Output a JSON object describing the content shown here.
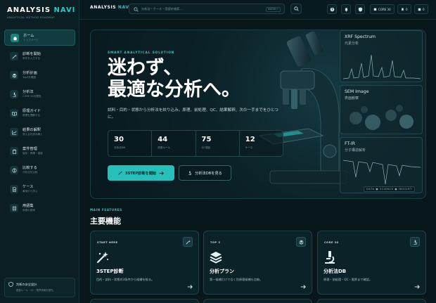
{
  "brand": {
    "name_main": "ANALYSIS",
    "name_accent": "NAVI",
    "tagline": "ANALYTICAL METHOD ROADMAP"
  },
  "topbar": {
    "title_main": "ANALYSIS",
    "title_accent": "NAVI",
    "search_placeholder": "分析法・ケース・用語を検索...",
    "search_shortcut": "ENTER ↵",
    "pills": {
      "core": "CORE 30",
      "saved": "0",
      "history": "0"
    }
  },
  "sidebar": {
    "items": [
      {
        "label": "ホーム",
        "sub": "トップページ",
        "icon": "home-icon"
      },
      {
        "label": "診断を開始",
        "sub": "条件を入力する",
        "icon": "wand-icon"
      },
      {
        "label": "分析計画",
        "sub": "Top3を確認",
        "icon": "layers-icon"
      },
      {
        "label": "分析法",
        "sub": "CORE 30を閲覧",
        "icon": "microscope-icon"
      },
      {
        "label": "原理ガイド",
        "sub": "原理を理解する",
        "icon": "book-icon"
      },
      {
        "label": "結果の解釈",
        "sub": "見えるを読み解く",
        "icon": "chart-icon"
      },
      {
        "label": "案件管理",
        "sub": "保存・再確・複製",
        "icon": "clipboard-icon"
      },
      {
        "label": "比較する",
        "sub": "分析法を比較",
        "icon": "compare-icon"
      },
      {
        "label": "ケース",
        "sub": "事例から学ぶ",
        "icon": "case-icon"
      },
      {
        "label": "用語集",
        "sub": "用語の説明",
        "icon": "glossary-icon"
      }
    ],
    "notice": {
      "title": "判断の安全設計",
      "sub": "推奨ルール・QC・限界情報を優先。"
    }
  },
  "hero": {
    "kicker": "SMART ANALYTICAL SOLUTION",
    "title_line1": "迷わず、",
    "title_line2": "最適な分析へ。",
    "description": "試料・目的・状態から分析法を絞り込み。原理、前処理、QC、結果解釈、次の一手までをひとつに。",
    "stats": [
      {
        "value": "30",
        "label": "分析法DB"
      },
      {
        "value": "44",
        "label": "診断ルール"
      },
      {
        "value": "75",
        "label": "QC項目"
      },
      {
        "value": "12",
        "label": "ケース"
      }
    ],
    "primary_button": "3STEP診断を開始",
    "secondary_button": "分析法DBを見る",
    "panels": [
      {
        "title": "XRF Spectrum",
        "sub": "元素分析"
      },
      {
        "title": "SEM Image",
        "sub": "表面観察"
      },
      {
        "title": "FT-IR",
        "sub": "分子構造解析"
      }
    ],
    "tagline": "DATA ● SCIENCE ● INSIGHT"
  },
  "features": {
    "kicker": "MAIN FEATURES",
    "title": "主要機能",
    "cards": [
      {
        "tag": "START HERE",
        "name": "3STEP診断",
        "desc": "目的・試料・状態の3条件から候補を絞る。"
      },
      {
        "tag": "TOP 3",
        "name": "分析プラン",
        "desc": "第一候補だけでなく別原理候補も比較。"
      },
      {
        "tag": "CORE 30",
        "name": "分析法DB",
        "desc": "原理・前処理・QC・限界まで確認。"
      }
    ]
  },
  "colors": {
    "accent": "#2bc8c2",
    "background": "#07171c",
    "panel": "#0b2228"
  }
}
